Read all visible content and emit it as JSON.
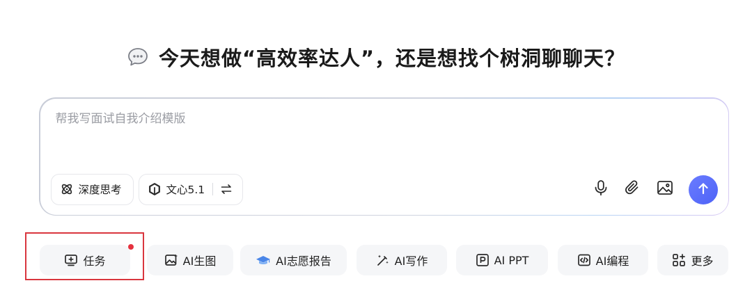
{
  "headline": {
    "text": "今天想做“高效率达人”，还是想找个树洞聊聊天？",
    "icon": "speech-bubble-icon"
  },
  "composer": {
    "placeholder": "帮我写面试自我介绍模版",
    "value": "",
    "deep_thinking_label": "深度思考",
    "model_label": "文心5.1"
  },
  "quick_actions": [
    {
      "label": "任务",
      "icon": "task-monitor-icon",
      "has_notification": true,
      "highlighted": true
    },
    {
      "label": "AI生图",
      "icon": "image-generate-icon"
    },
    {
      "label": "AI志愿报告",
      "icon": "graduation-cap-icon"
    },
    {
      "label": "AI写作",
      "icon": "magic-pen-icon"
    },
    {
      "label": "AI PPT",
      "icon": "ppt-icon"
    },
    {
      "label": "AI编程",
      "icon": "code-icon"
    },
    {
      "label": "更多",
      "icon": "apps-grid-icon"
    }
  ],
  "colors": {
    "accent": "#5a6ffa",
    "notification": "#e5323f",
    "highlight_box": "#d9363e",
    "chip_background": "#f5f6f8"
  }
}
